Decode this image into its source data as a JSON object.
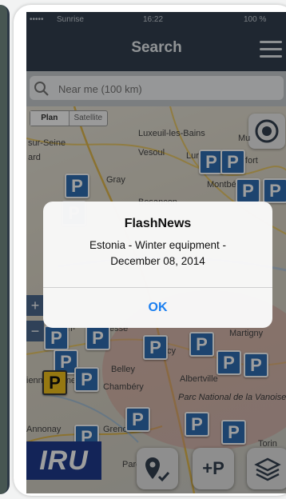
{
  "status_bar": {
    "carrier": "Sunrise",
    "time": "16:22",
    "battery": "100 %"
  },
  "header": {
    "title": "Search"
  },
  "search": {
    "placeholder": "Near me (100 km)"
  },
  "map": {
    "mode_plan": "Plan",
    "mode_satellite": "Satellite",
    "places": [
      "Luxeuil-les-Bains",
      "Mu",
      "Vesoul",
      "Lure",
      "Belfort",
      "Gray",
      "Montbéliard",
      "Besancon",
      "Belley",
      "Chambéry",
      "Albertville",
      "Parc National de la Vanoise",
      "Martigny",
      "Vienne",
      "Annonay",
      "Grenoble",
      "Torin",
      "sur-Seine",
      "ard",
      "ienne",
      "rg-en-",
      "esse",
      "cy",
      "Parc"
    ],
    "logo_text": "IRU"
  },
  "dialog": {
    "title": "FlashNews",
    "message_line1": "Estonia - Winter equipment -",
    "message_line2": "December 08, 2014",
    "ok_label": "OK"
  },
  "actions": {
    "add_parking_label": "+P"
  },
  "colors": {
    "header": "#33404f",
    "marker": "#2f6fb4",
    "accent": "#1b7ff0"
  }
}
